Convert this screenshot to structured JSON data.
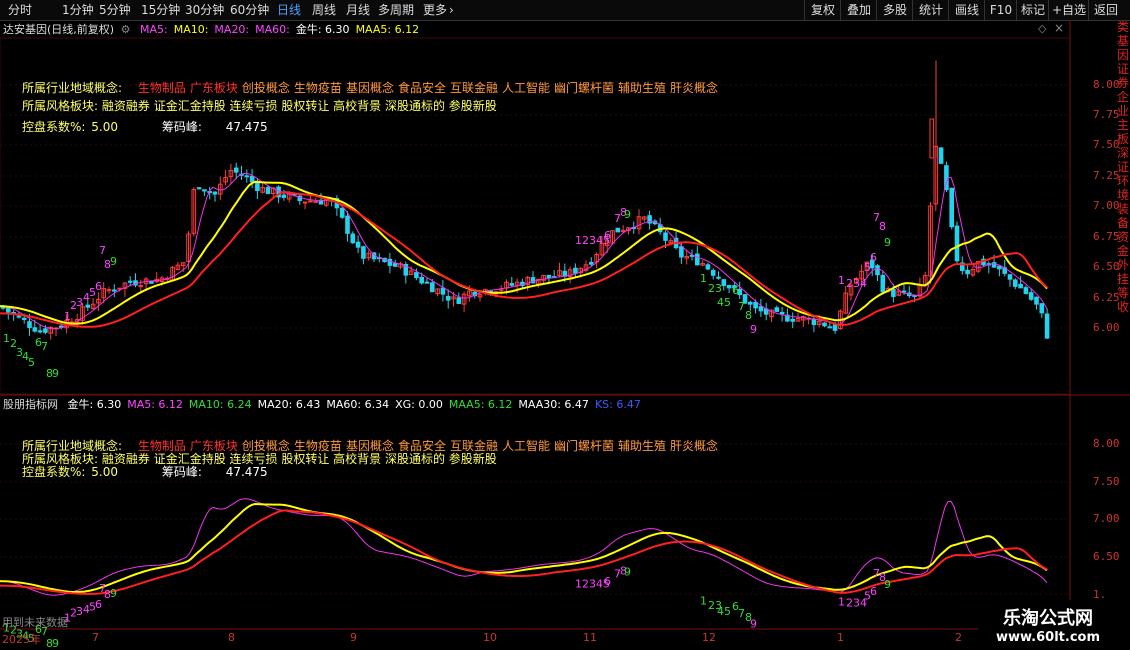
{
  "toolbar": {
    "periods": [
      "分时",
      "1分钟",
      "5分钟",
      "15分钟",
      "30分钟",
      "60分钟",
      "日线",
      "周线",
      "月线",
      "多周期",
      "更多"
    ],
    "active_period": "日线",
    "more_chevron": "›",
    "right_buttons": [
      "复权",
      "叠加",
      "多股",
      "统计",
      "画线",
      "F10",
      "标记",
      "+自选",
      "返回"
    ]
  },
  "main_panel": {
    "stock_title": "达安基因(日线,前复权)",
    "indicators": [
      {
        "label": "MA5:",
        "color": "#ff44ff"
      },
      {
        "label": "MA10:",
        "color": "#ffff00"
      },
      {
        "label": "MA20:",
        "color": "#ff44ff"
      },
      {
        "label": "MA60:",
        "color": "#ff44ff"
      },
      {
        "label": "金牛: 6.30",
        "color": "#ffffff"
      },
      {
        "label": "MAA5: 6.12",
        "color": "#ffff00"
      }
    ],
    "y_axis": [
      "8.00",
      "7.75",
      "7.50",
      "7.25",
      "7.00",
      "6.75",
      "6.50",
      "6.25",
      "6.00"
    ],
    "industry_label": "所属行业地域概念:",
    "industry_values": [
      {
        "text": "生物制品",
        "color": "#ff3030"
      },
      {
        "text": "广东板块",
        "color": "#ff3030"
      },
      {
        "text": "创投概念",
        "color": "#ff9a3c"
      },
      {
        "text": "生物疫苗",
        "color": "#ff9a3c"
      },
      {
        "text": "基因概念",
        "color": "#ff9a3c"
      },
      {
        "text": "食品安全",
        "color": "#ff9a3c"
      },
      {
        "text": "互联金融",
        "color": "#ff9a3c"
      },
      {
        "text": "人工智能",
        "color": "#ff9a3c"
      },
      {
        "text": "幽门螺杆菌",
        "color": "#ff9a3c"
      },
      {
        "text": "辅助生殖",
        "color": "#ff9a3c"
      },
      {
        "text": "肝炎概念",
        "color": "#ff9a3c"
      }
    ],
    "style_label": "所属风格板块:",
    "style_values": "融资融券 证金汇金持股 连续亏损 股权转让 高校背景 深股通标的 参股新股",
    "control_label": "控盘系数%:",
    "control_value": "5.00",
    "chip_label": "筹码峰:",
    "chip_value": "47.475"
  },
  "sub_panel": {
    "title": "股朋指标网",
    "indicators": [
      {
        "label": "金牛: 6.30",
        "color": "#ffffff"
      },
      {
        "label": "MA5: 6.12",
        "color": "#ff44ff"
      },
      {
        "label": "MA10: 6.24",
        "color": "#33dd33"
      },
      {
        "label": "MA20: 6.43",
        "color": "#ffffff"
      },
      {
        "label": "MA60: 6.34",
        "color": "#ffffff"
      },
      {
        "label": "XG: 0.00",
        "color": "#ffffff"
      },
      {
        "label": "MAA5: 6.12",
        "color": "#33dd33"
      },
      {
        "label": "MAA30: 6.47",
        "color": "#ffffff"
      },
      {
        "label": "KS: 6.47",
        "color": "#3b5bff"
      }
    ],
    "y_axis": [
      "8.00",
      "7.50",
      "7.00",
      "6.50"
    ],
    "y_axis_partial": "1.",
    "footer_text": "用到未来数据"
  },
  "x_axis": [
    "2025年",
    "7",
    "8",
    "9",
    "10",
    "11",
    "12",
    "1",
    "2"
  ],
  "right_strip": "类基因证券企业主板深证环境装备资金外挂等收",
  "watermark": {
    "line1": "乐淘公式网",
    "line2": "www.60lt.com"
  },
  "counters_main": [
    {
      "text": "1",
      "color": "#33dd33"
    },
    {
      "text": "2",
      "color": "#33dd33"
    },
    {
      "text": "3",
      "color": "#33dd33"
    },
    {
      "text": "4",
      "color": "#33dd33"
    },
    {
      "text": "5",
      "color": "#33dd33"
    },
    {
      "text": "6",
      "color": "#33dd33"
    },
    {
      "text": "7",
      "color": "#33dd33"
    },
    {
      "text": "8",
      "color": "#33dd33"
    },
    {
      "text": "9",
      "color": "#33dd33"
    },
    {
      "text": "1",
      "color": "#ff44ff"
    },
    {
      "text": "2",
      "color": "#ff44ff"
    },
    {
      "text": "3",
      "color": "#ff44ff"
    },
    {
      "text": "4",
      "color": "#ff44ff"
    },
    {
      "text": "5",
      "color": "#ff44ff"
    },
    {
      "text": "6",
      "color": "#ff44ff"
    },
    {
      "text": "7",
      "color": "#ff44ff"
    },
    {
      "text": "8",
      "color": "#ff44ff"
    },
    {
      "text": "9",
      "color": "#33dd33"
    },
    {
      "text": "12345",
      "color": "#ff44ff"
    },
    {
      "text": "6",
      "color": "#ff44ff"
    },
    {
      "text": "7",
      "color": "#ff44ff"
    },
    {
      "text": "8",
      "color": "#ff44ff"
    },
    {
      "text": "9",
      "color": "#33dd33"
    },
    {
      "text": "1",
      "color": "#33dd33"
    },
    {
      "text": "23",
      "color": "#33dd33"
    },
    {
      "text": "45",
      "color": "#33dd33"
    },
    {
      "text": "6",
      "color": "#33dd33"
    },
    {
      "text": "7",
      "color": "#33dd33"
    },
    {
      "text": "8",
      "color": "#33dd33"
    },
    {
      "text": "9",
      "color": "#ff44ff"
    },
    {
      "text": "1",
      "color": "#ff44ff"
    },
    {
      "text": "234",
      "color": "#ff44ff"
    },
    {
      "text": "5",
      "color": "#ff44ff"
    },
    {
      "text": "6",
      "color": "#ff44ff"
    },
    {
      "text": "7",
      "color": "#ff44ff"
    },
    {
      "text": "8",
      "color": "#ff44ff"
    },
    {
      "text": "9",
      "color": "#33dd33"
    }
  ]
}
